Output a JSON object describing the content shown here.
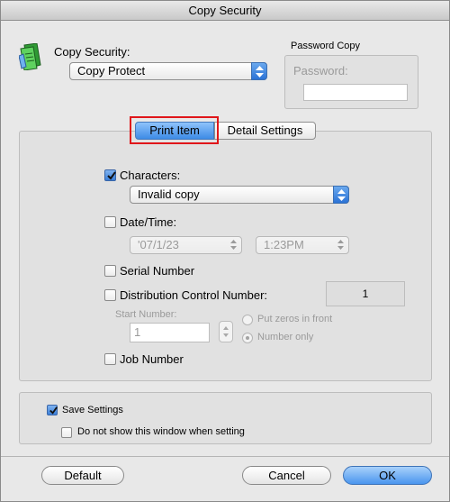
{
  "window": {
    "title": "Copy Security"
  },
  "copy_security": {
    "label": "Copy Security:",
    "selected": "Copy Protect",
    "icon": "copy-security-icon"
  },
  "password_copy": {
    "group_label": "Password Copy",
    "password_label": "Password:",
    "password_value": ""
  },
  "tabs": [
    {
      "label": "Print Item",
      "active": true
    },
    {
      "label": "Detail Settings",
      "active": false
    }
  ],
  "print_item": {
    "characters": {
      "label": "Characters:",
      "checked": true,
      "selected": "Invalid copy"
    },
    "date_time": {
      "label": "Date/Time:",
      "checked": false,
      "date_value": "'07/1/23",
      "time_value": "1:23PM"
    },
    "serial_number": {
      "label": "Serial Number",
      "checked": false
    },
    "distribution_control_number": {
      "label": "Distribution Control Number:",
      "checked": false,
      "value": "1"
    },
    "start_number": {
      "label": "Start Number:",
      "value": "1"
    },
    "zero_options": [
      {
        "label": "Put zeros in front",
        "selected": false
      },
      {
        "label": "Number only",
        "selected": true
      }
    ],
    "job_number": {
      "label": "Job Number",
      "checked": false
    }
  },
  "save_settings": {
    "label": "Save Settings",
    "checked": true,
    "do_not_show_label": "Do not show this window when setting",
    "do_not_show_checked": false
  },
  "buttons": {
    "default": "Default",
    "cancel": "Cancel",
    "ok": "OK"
  },
  "colors": {
    "highlight_box": "#e0161a",
    "accent_blue": "#3d8be6"
  }
}
